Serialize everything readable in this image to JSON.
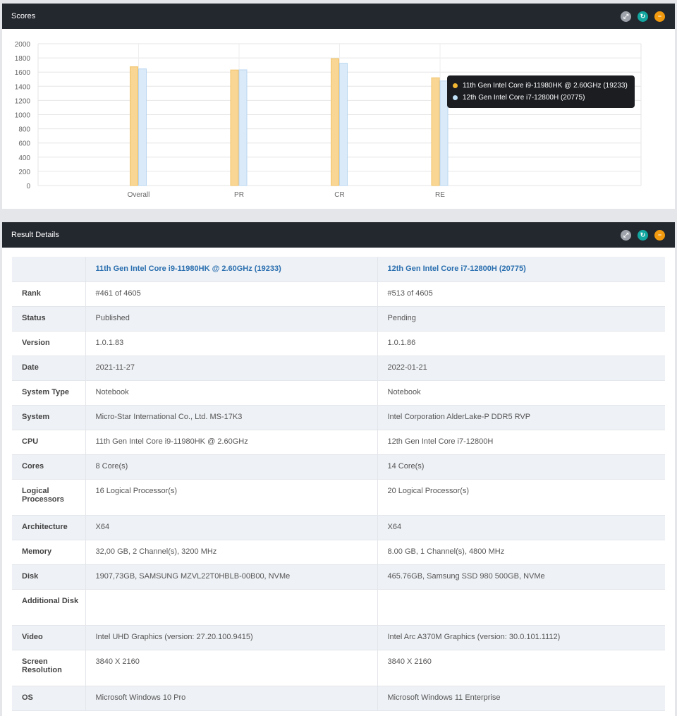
{
  "scores_panel": {
    "title": "Scores",
    "controls": [
      "expand-icon",
      "refresh-icon",
      "minimize-icon"
    ]
  },
  "details_panel": {
    "title": "Result Details",
    "controls": [
      "expand-icon",
      "refresh-icon",
      "minimize-icon"
    ]
  },
  "colors": {
    "series1": "#f9d693",
    "series1_dot": "#f2b632",
    "series2": "#dbeaf8",
    "series2_dot": "#bfe0f7",
    "header_bg": "#23272e",
    "link": "#2a6fb0"
  },
  "chart_data": {
    "type": "bar",
    "categories": [
      "Overall",
      "PR",
      "CR",
      "RE"
    ],
    "series": [
      {
        "name": "11th Gen Intel Core i9-11980HK @ 2.60GHz (19233)",
        "values": [
          1675,
          1630,
          1790,
          1520
        ]
      },
      {
        "name": "12th Gen Intel Core i7-12800H (20775)",
        "values": [
          1645,
          1632,
          1725,
          1475
        ]
      }
    ],
    "ylim": [
      0,
      2000
    ],
    "yticks": [
      0,
      200,
      400,
      600,
      800,
      1000,
      1200,
      1400,
      1600,
      1800,
      2000
    ],
    "grid": true,
    "legend": "tooltip top-right"
  },
  "details": {
    "col1_header": "11th Gen Intel Core i9-11980HK @ 2.60GHz (19233)",
    "col2_header": "12th Gen Intel Core i7-12800H (20775)",
    "rows": [
      {
        "label": "Rank",
        "v1": "#461 of 4605",
        "v2": "#513 of 4605"
      },
      {
        "label": "Status",
        "v1": "Published",
        "v2": "Pending"
      },
      {
        "label": "Version",
        "v1": "1.0.1.83",
        "v2": "1.0.1.86"
      },
      {
        "label": "Date",
        "v1": "2021-11-27",
        "v2": "2022-01-21"
      },
      {
        "label": "System Type",
        "v1": "Notebook",
        "v2": "Notebook"
      },
      {
        "label": "System",
        "v1": "Micro-Star International Co., Ltd. MS-17K3",
        "v2": "Intel Corporation AlderLake-P DDR5 RVP"
      },
      {
        "label": "CPU",
        "v1": "11th Gen Intel Core i9-11980HK @ 2.60GHz",
        "v2": "12th Gen Intel Core i7-12800H"
      },
      {
        "label": "Cores",
        "v1": "8 Core(s)",
        "v2": "14 Core(s)"
      },
      {
        "label": "Logical Processors",
        "v1": "16 Logical Processor(s)",
        "v2": "20 Logical Processor(s)"
      },
      {
        "label": "Architecture",
        "v1": "X64",
        "v2": "X64"
      },
      {
        "label": "Memory",
        "v1": "32,00 GB, 2 Channel(s), 3200 MHz",
        "v2": "8.00 GB, 1 Channel(s), 4800 MHz"
      },
      {
        "label": "Disk",
        "v1": "1907,73GB, SAMSUNG MZVL22T0HBLB-00B00, NVMe",
        "v2": "465.76GB, Samsung SSD 980 500GB, NVMe"
      },
      {
        "label": "Additional Disk",
        "v1": "",
        "v2": ""
      },
      {
        "label": "Video",
        "v1": "Intel UHD Graphics (version: 27.20.100.9415)",
        "v2": "Intel Arc A370M Graphics (version: 30.0.101.1112)"
      },
      {
        "label": "Screen Resolution",
        "v1": "3840 X 2160",
        "v2": "3840 X 2160"
      },
      {
        "label": "OS",
        "v1": "Microsoft Windows 10 Pro",
        "v2": "Microsoft Windows 11 Enterprise"
      }
    ]
  }
}
